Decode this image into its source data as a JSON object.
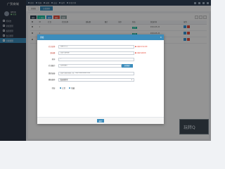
{
  "sidebar": {
    "logo": "广贸商城",
    "user_name": "Admin",
    "user_status": "● 在线",
    "items": [
      {
        "label": "控制台",
        "active": false
      },
      {
        "label": "常规管理",
        "active": false
      },
      {
        "label": "权限管理",
        "active": false
      },
      {
        "label": "会员管理",
        "active": false
      },
      {
        "label": "分类管理",
        "active": true
      }
    ]
  },
  "topbar": {
    "links": [
      "首页",
      "常规",
      "权限",
      "会员",
      "插件",
      "开发示例"
    ]
  },
  "tabs": [
    "控制台",
    "分类管理"
  ],
  "toolbar": {
    "buttons": [
      {
        "label": "刷新",
        "color": "#2c3e50"
      },
      {
        "label": "+ 添加",
        "color": "#18bc9c"
      },
      {
        "label": "编辑",
        "color": "#3498db"
      },
      {
        "label": "删除",
        "color": "#e74c3c"
      },
      {
        "label": "更多",
        "color": "#95a5a6"
      }
    ]
  },
  "grid": {
    "headers": [
      "ID",
      "栏目",
      "栏目名称",
      "副标题",
      "图片",
      "排序",
      "状态",
      "添加时间",
      "操作"
    ],
    "rows": [
      {
        "id": "1",
        "date": "2024-05-24"
      },
      {
        "id": "2",
        "date": "2024-05-24"
      },
      {
        "id": "3",
        "date": "2024-05-24"
      }
    ],
    "status_label": "正常"
  },
  "promo_text": "玩转Q",
  "modal": {
    "title": "添加",
    "close": "✕",
    "fields": {
      "name": {
        "label": "栏目名称:",
        "placeholder": "请输入栏目",
        "error": "请填写栏目名称"
      },
      "subtitle": {
        "label": "副标题:",
        "placeholder": "请填写副标题",
        "error": "请填写副标题"
      },
      "weigh": {
        "label": "排序:",
        "placeholder": "0"
      },
      "image": {
        "label": "栏目图片:",
        "placeholder": "请选择图片",
        "button": "选择图片"
      },
      "url": {
        "label": "跳转链接:",
        "placeholder": "请填写跳转链接，如：http://www.baidu.com"
      },
      "type": {
        "label": "跳转类型:",
        "value": "请选择类型"
      },
      "status": {
        "label": "状态:",
        "options": [
          "正常",
          "隐藏"
        ]
      }
    },
    "ok_label": "确定"
  }
}
